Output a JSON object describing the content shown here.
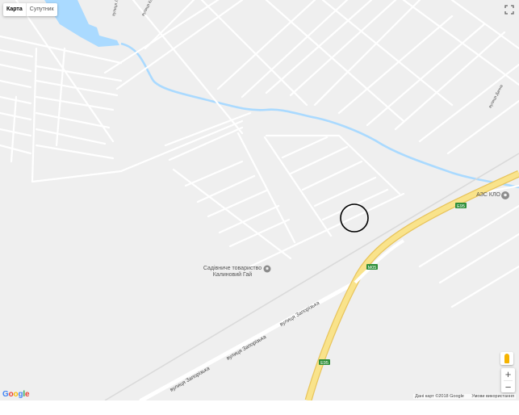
{
  "map_type": {
    "map_label": "Карта",
    "satellite_label": "Супутник"
  },
  "controls": {
    "fullscreen_icon": "fullscreen-icon",
    "zoom_in": "+",
    "zoom_out": "−",
    "pegman_icon": "street-view-pegman-icon"
  },
  "branding": {
    "logo_letters": [
      "G",
      "o",
      "o",
      "g",
      "l",
      "e"
    ],
    "logo_colors": [
      "#4285F4",
      "#EA4335",
      "#FBBC05",
      "#4285F4",
      "#34A853",
      "#EA4335"
    ]
  },
  "attribution": {
    "data_text": "Дані карт ©2018 Google",
    "terms_text": "Умови використання"
  },
  "places": {
    "garden": {
      "line1": "Садівниче товариство",
      "line2": "Калиновий Гай"
    },
    "gas_station": {
      "label": "АЗС КЛО"
    }
  },
  "routes": {
    "e95_a": "E95",
    "e95_b": "E95",
    "m05": "M05"
  },
  "streets": {
    "zaporizka_1": "вулиця Запорізька",
    "zaporizka_2": "вулиця Запорізька",
    "zaporizka_3": "вулиця Запорізька",
    "top_street": "вулиця Лісова",
    "right_street": "вулиця Дачна",
    "right_street_2": "вулиця Калинова"
  },
  "colors": {
    "land": "#efefef",
    "road": "#ffffff",
    "water": "#aadaff",
    "highway_fill": "#f9e38b",
    "highway_edge": "#e8c45c",
    "poi": "#8c8c8c"
  }
}
